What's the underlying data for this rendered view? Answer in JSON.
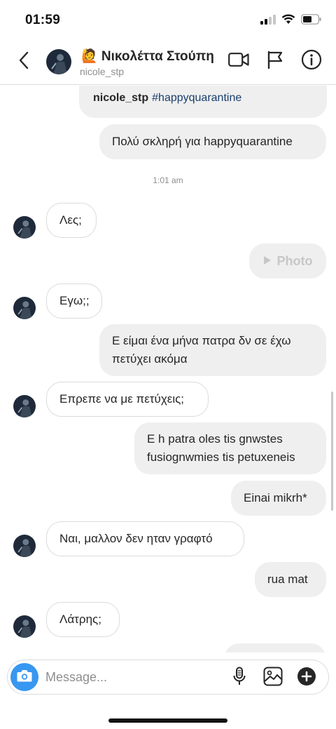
{
  "status_bar": {
    "time": "01:59"
  },
  "header": {
    "name": "🙋 Νικολέττα Στούπη",
    "username": "nicole_stp"
  },
  "shared_post": {
    "username": "nicole_stp",
    "hashtag": "#happyquarantine"
  },
  "messages": [
    {
      "side": "sent",
      "text": "Πολύ σκληρή για happyquarantine"
    },
    {
      "side": "timestamp",
      "text": "1:01 am"
    },
    {
      "side": "recv",
      "text": "Λες;"
    },
    {
      "side": "sent-photo",
      "text": "Photo"
    },
    {
      "side": "recv",
      "text": "Εγω;;"
    },
    {
      "side": "sent",
      "lines": [
        "Ε είμαι ένα μήνα πατρα δν σε έχω",
        "πετύχει ακόμα"
      ]
    },
    {
      "side": "recv",
      "text": "Επρεπε να με πετύχεις;"
    },
    {
      "side": "sent",
      "lines": [
        "E h patra oles tis gnwstes",
        "fusiognwmies tis petuxeneis"
      ]
    },
    {
      "side": "sent",
      "text": "Einai mikrh*"
    },
    {
      "side": "recv",
      "text": "Ναι, μαλλον δεν ηταν γραφτό"
    },
    {
      "side": "sent",
      "text": "rua mat"
    },
    {
      "side": "recv",
      "text": "Λάτρης;"
    }
  ],
  "composer": {
    "placeholder": "Message..."
  },
  "icons": {
    "back": "chevron-left-icon",
    "video": "video-camera-icon",
    "flag": "flag-icon",
    "info": "info-icon",
    "camera": "camera-icon",
    "mic": "microphone-icon",
    "gallery": "gallery-icon",
    "add": "plus-circle-icon",
    "play": "play-icon"
  },
  "colors": {
    "accent": "#3897f0",
    "sent_bubble": "#efefef",
    "border": "#dbdbdb",
    "hashtag": "#1a3e6e",
    "muted_text": "#8e8e8e"
  }
}
